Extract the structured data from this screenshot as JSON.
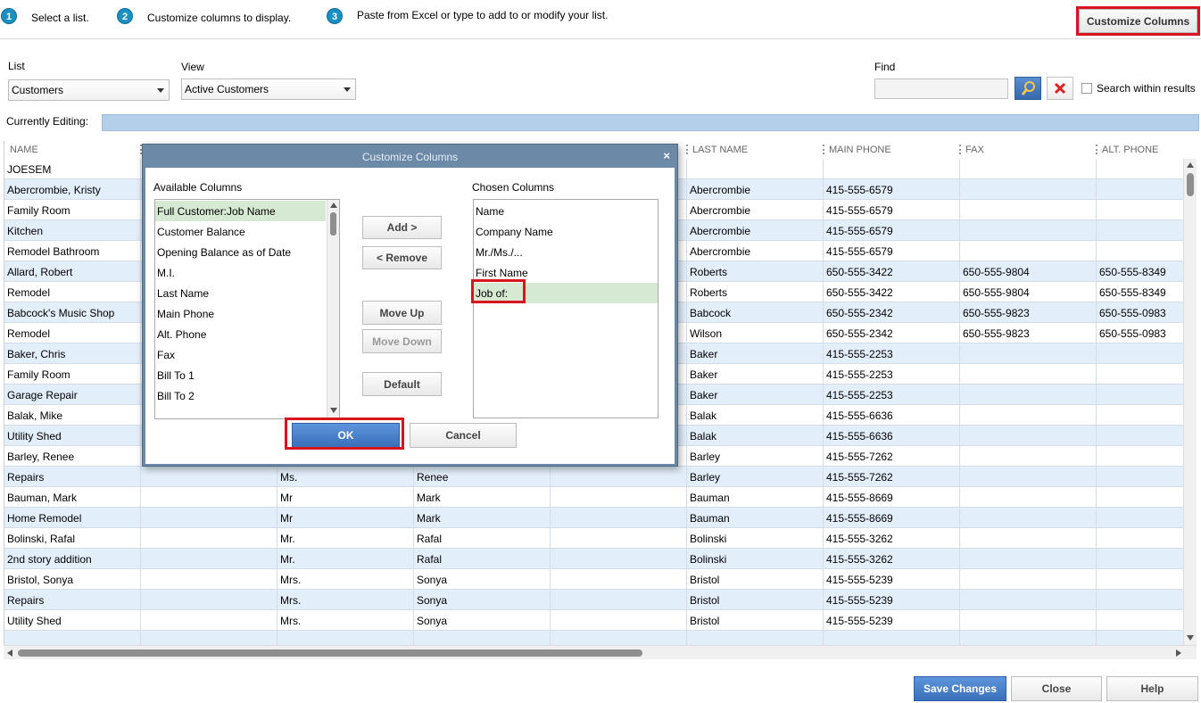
{
  "steps": [
    {
      "num": "1",
      "text": "Select a list."
    },
    {
      "num": "2",
      "text": "Customize columns to display."
    },
    {
      "num": "3",
      "text": "Paste from Excel or type to add to or modify your list."
    }
  ],
  "customize_columns_label": "Customize Columns",
  "list": {
    "label": "List",
    "value": "Customers"
  },
  "view": {
    "label": "View",
    "value": "Active Customers"
  },
  "find": {
    "label": "Find",
    "value": "",
    "search_within_label": "Search within results"
  },
  "currently_editing": {
    "label": "Currently Editing:",
    "value": ""
  },
  "columns": [
    "NAME",
    "",
    "",
    "",
    "",
    "LAST NAME",
    "MAIN PHONE",
    "FAX",
    "ALT. PHONE"
  ],
  "rows": [
    [
      "JOESEM",
      "",
      "",
      "",
      "",
      "",
      "",
      "",
      ""
    ],
    [
      "Abercrombie, Kristy",
      "",
      "",
      "",
      "",
      "Abercrombie",
      "415-555-6579",
      "",
      ""
    ],
    [
      "Family Room",
      "",
      "",
      "",
      "",
      "Abercrombie",
      "415-555-6579",
      "",
      ""
    ],
    [
      "Kitchen",
      "",
      "",
      "",
      "",
      "Abercrombie",
      "415-555-6579",
      "",
      ""
    ],
    [
      "Remodel Bathroom",
      "",
      "",
      "",
      "",
      "Abercrombie",
      "415-555-6579",
      "",
      ""
    ],
    [
      "Allard, Robert",
      "",
      "",
      "",
      "",
      "Roberts",
      "650-555-3422",
      "650-555-9804",
      "650-555-8349"
    ],
    [
      "Remodel",
      "",
      "",
      "",
      "",
      "Roberts",
      "650-555-3422",
      "650-555-9804",
      "650-555-8349"
    ],
    [
      "Babcock's Music Shop",
      "",
      "",
      "",
      "",
      "Babcock",
      "650-555-2342",
      "650-555-9823",
      "650-555-0983"
    ],
    [
      "Remodel",
      "",
      "",
      "",
      "",
      "Wilson",
      "650-555-2342",
      "650-555-9823",
      "650-555-0983"
    ],
    [
      "Baker, Chris",
      "",
      "",
      "",
      "",
      "Baker",
      "415-555-2253",
      "",
      ""
    ],
    [
      "Family Room",
      "",
      "",
      "",
      "",
      "Baker",
      "415-555-2253",
      "",
      ""
    ],
    [
      "Garage Repair",
      "",
      "",
      "",
      "",
      "Baker",
      "415-555-2253",
      "",
      ""
    ],
    [
      "Balak, Mike",
      "",
      "",
      "",
      "",
      "Balak",
      "415-555-6636",
      "",
      ""
    ],
    [
      "Utility Shed",
      "",
      "",
      "",
      "",
      "Balak",
      "415-555-6636",
      "",
      ""
    ],
    [
      "Barley, Renee",
      "",
      "",
      "",
      "",
      "Barley",
      "415-555-7262",
      "",
      ""
    ],
    [
      "Repairs",
      "",
      "Ms.",
      "Renee",
      "",
      "Barley",
      "415-555-7262",
      "",
      ""
    ],
    [
      "Bauman, Mark",
      "",
      "Mr",
      "Mark",
      "",
      "Bauman",
      "415-555-8669",
      "",
      ""
    ],
    [
      "Home Remodel",
      "",
      "Mr",
      "Mark",
      "",
      "Bauman",
      "415-555-8669",
      "",
      ""
    ],
    [
      "Bolinski, Rafal",
      "",
      "Mr.",
      "Rafal",
      "",
      "Bolinski",
      "415-555-3262",
      "",
      ""
    ],
    [
      "2nd story addition",
      "",
      "Mr.",
      "Rafal",
      "",
      "Bolinski",
      "415-555-3262",
      "",
      ""
    ],
    [
      "Bristol, Sonya",
      "",
      "Mrs.",
      "Sonya",
      "",
      "Bristol",
      "415-555-5239",
      "",
      ""
    ],
    [
      "Repairs",
      "",
      "Mrs.",
      "Sonya",
      "",
      "Bristol",
      "415-555-5239",
      "",
      ""
    ],
    [
      "Utility Shed",
      "",
      "Mrs.",
      "Sonya",
      "",
      "Bristol",
      "415-555-5239",
      "",
      ""
    ],
    [
      "",
      "",
      "",
      "",
      "",
      "",
      "",
      "",
      ""
    ]
  ],
  "dialog": {
    "title": "Customize Columns",
    "close": "×",
    "available_label": "Available Columns",
    "chosen_label": "Chosen Columns",
    "available": [
      "Full Customer:Job Name",
      "Customer Balance",
      "Opening Balance as of Date",
      "M.I.",
      "Last Name",
      "Main Phone",
      "Alt. Phone",
      "Fax",
      "Bill To 1",
      "Bill To 2"
    ],
    "chosen": [
      "Name",
      "Company Name",
      "Mr./Ms./...",
      "First Name",
      "Job of:"
    ],
    "add": "Add >",
    "remove": "< Remove",
    "move_up": "Move Up",
    "move_down": "Move Down",
    "default": "Default",
    "ok": "OK",
    "cancel": "Cancel"
  },
  "footer": {
    "save": "Save Changes",
    "close": "Close",
    "help": "Help"
  }
}
